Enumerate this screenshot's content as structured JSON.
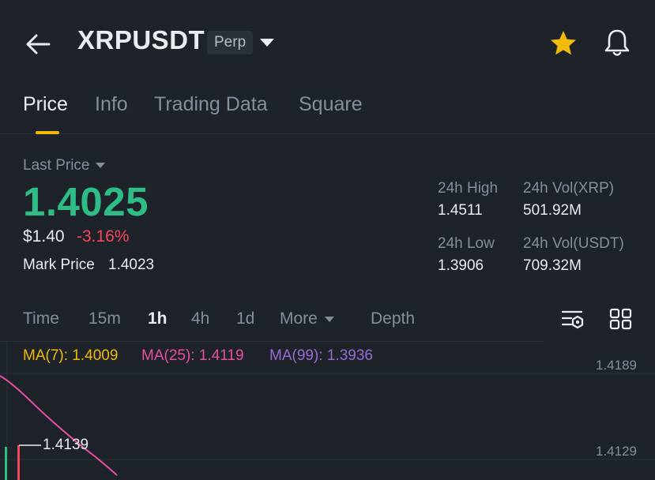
{
  "header": {
    "symbol": "XRPUSDT",
    "contract_badge": "Perp",
    "accent_color": "#f0b90b"
  },
  "tabs": [
    {
      "label": "Price",
      "active": true
    },
    {
      "label": "Info",
      "active": false
    },
    {
      "label": "Trading Data",
      "active": false
    },
    {
      "label": "Square",
      "active": false
    }
  ],
  "price": {
    "last_price_label": "Last Price",
    "last_price": "1.4025",
    "usd_price": "$1.40",
    "change_percent": "-3.16%",
    "mark_price_label": "Mark Price",
    "mark_price": "1.4023",
    "up_color": "#2ebd85",
    "down_color": "#f6465d"
  },
  "stats": {
    "high_label": "24h High",
    "high_value": "1.4511",
    "vol_base_label": "24h Vol(XRP)",
    "vol_base_value": "501.92M",
    "low_label": "24h Low",
    "low_value": "1.3906",
    "vol_quote_label": "24h Vol(USDT)",
    "vol_quote_value": "709.32M"
  },
  "intervals": [
    {
      "label": "Time",
      "active": false
    },
    {
      "label": "15m",
      "active": false
    },
    {
      "label": "1h",
      "active": true
    },
    {
      "label": "4h",
      "active": false
    },
    {
      "label": "1d",
      "active": false
    },
    {
      "label": "More",
      "active": false
    },
    {
      "label": "Depth",
      "active": false
    }
  ],
  "indicators": {
    "ma7": "MA(7): 1.4009",
    "ma25": "MA(25): 1.4119",
    "ma99": "MA(99): 1.3936",
    "ma7_color": "#f0b90b",
    "ma25_color": "#e84fa3",
    "ma99_color": "#9c6ad6"
  },
  "chart": {
    "axis_top": "1.4189",
    "axis_bottom": "1.4129",
    "high_marker": "1.4139"
  },
  "icons": [
    "back-arrow-icon",
    "dropdown-caret-icon",
    "star-icon",
    "bell-icon",
    "chart-settings-icon",
    "grid-layout-icon"
  ]
}
